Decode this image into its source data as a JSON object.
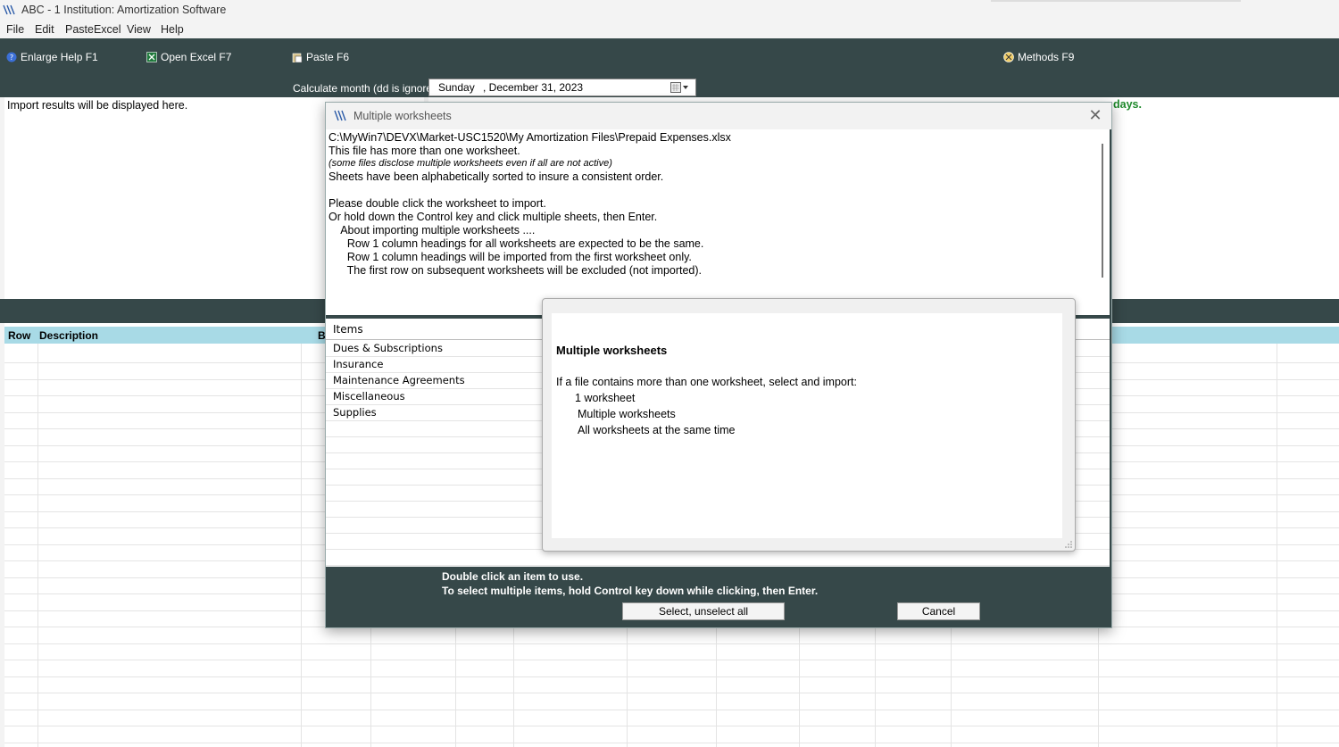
{
  "window": {
    "title": "ABC - 1 Institution: Amortization Software"
  },
  "menu": [
    "File",
    "Edit",
    "PasteExcel",
    "View",
    "Help"
  ],
  "toolbar": {
    "enlarge_help": "Enlarge Help  F1",
    "open_excel": "Open Excel  F7",
    "paste": "Paste  F6",
    "methods": "Methods  F9"
  },
  "calc": {
    "label": "Calculate month (dd is ignored)",
    "day": "Sunday",
    "date": ", December 31, 2023"
  },
  "import_panel": {
    "text": "Import results will be displayed here."
  },
  "right_panel": {
    "green_text": "days."
  },
  "grid": {
    "headers": [
      "Row",
      "Description",
      "B"
    ]
  },
  "dialog": {
    "title": "Multiple worksheets",
    "info_lines": [
      "C:\\MyWin7\\DEVX\\Market-USC1520\\My Amortization Files\\Prepaid Expenses.xlsx",
      "This file has more than one worksheet.",
      "(some files disclose multiple worksheets even if all are not active)",
      "Sheets have been alphabetically sorted to insure a consistent order.",
      "",
      "Please double click the worksheet to import.",
      "Or hold down the Control key and click multiple sheets, then Enter.",
      "    About importing multiple worksheets ....",
      "      Row 1 column headings for all worksheets are expected to be the same.",
      "      Row 1 column headings will be imported from the first worksheet only.",
      "      The first row on subsequent worksheets will be excluded (not imported)."
    ],
    "list_header": "Items",
    "items": [
      "Dues & Subscriptions",
      "Insurance",
      "Maintenance Agreements",
      "Miscellaneous",
      "Supplies"
    ],
    "hint1": "Double click an item to use.",
    "hint2": "To select multiple items, hold Control key down while clicking, then Enter.",
    "select_all_label": "Select, unselect all",
    "cancel_label": "Cancel"
  },
  "help_popup": {
    "title": "Multiple worksheets",
    "intro": "If a file contains more than one worksheet, select and import:",
    "options": [
      "1 worksheet",
      "Multiple worksheets",
      "All worksheets at the same time"
    ]
  },
  "colors": {
    "dark_band": "#364849",
    "grid_header": "#a8dae6",
    "green": "#1f8a2c"
  }
}
